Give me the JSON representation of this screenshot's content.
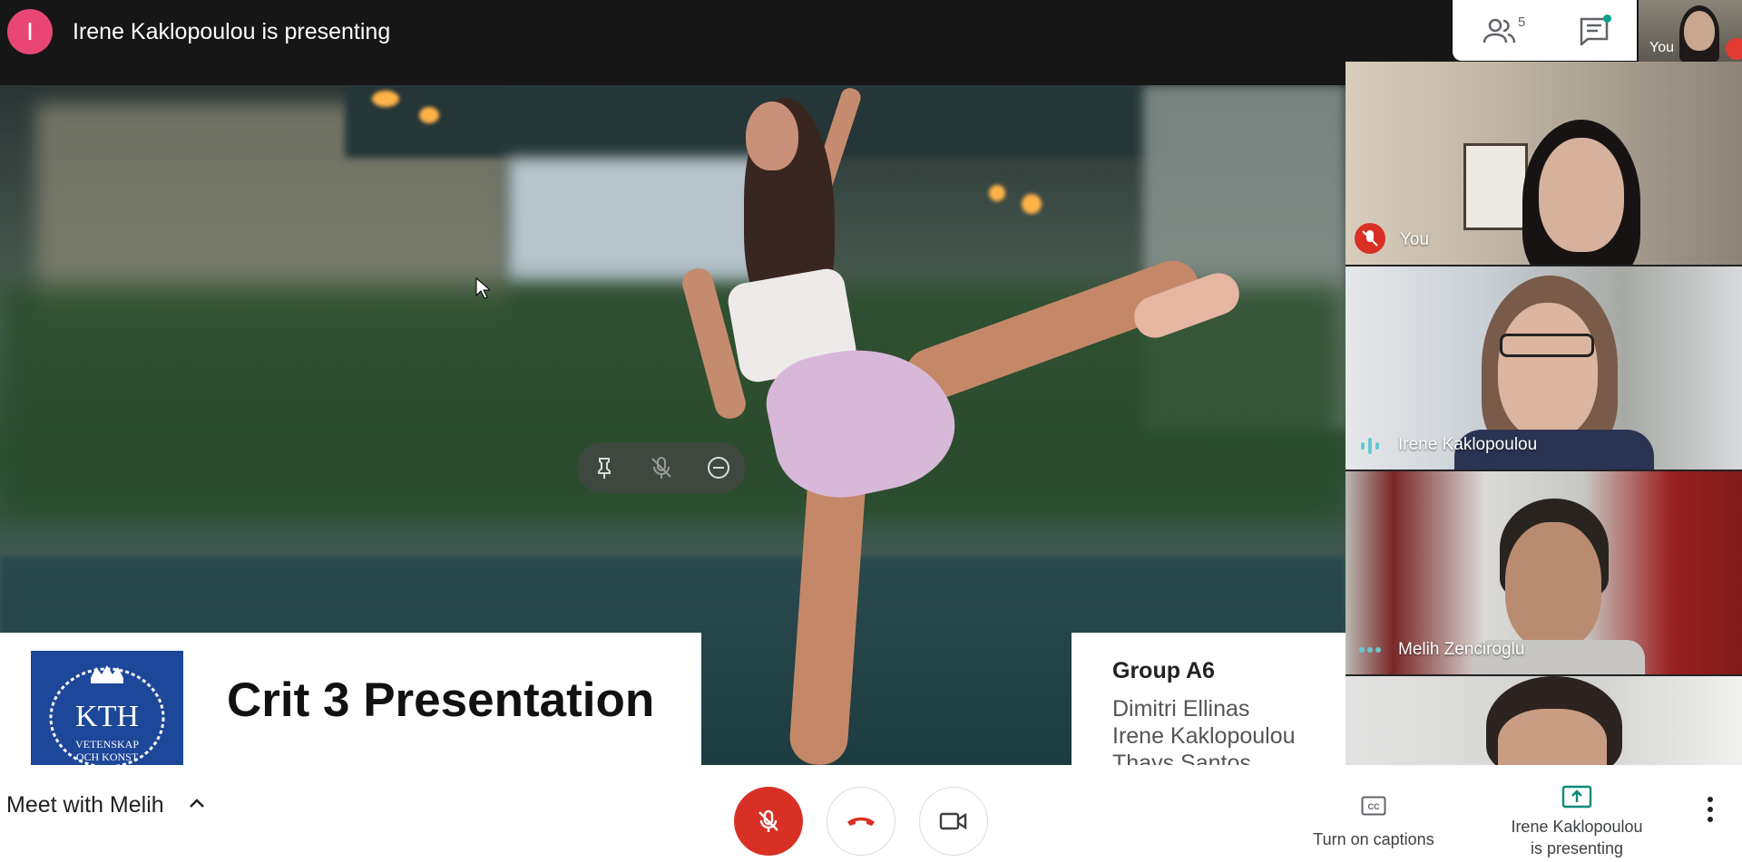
{
  "header": {
    "presenter_initial": "I",
    "presenting_text": "Irene Kaklopoulou is presenting",
    "people_count": "5",
    "self_label": "You"
  },
  "slide": {
    "logo_text_main": "KTH",
    "logo_text_sub1": "VETENSKAP",
    "logo_text_sub2": "OCH KONST",
    "title": "Crit 3 Presentation",
    "group_title": "Group A6",
    "members": [
      "Dimitri Ellinas",
      "Irene Kaklopoulou",
      "Thays Santos"
    ]
  },
  "participants": [
    {
      "name": "You",
      "status": "muted"
    },
    {
      "name": "Irene Kaklopoulou",
      "status": "speaking"
    },
    {
      "name": "Melih Zenciroglu",
      "status": "active"
    },
    {
      "name": "",
      "status": "video"
    }
  ],
  "bottom": {
    "meeting_title": "Meet with Melih",
    "captions_label": "Turn on captions",
    "presenting_line1": "Irene Kaklopoulou",
    "presenting_line2": "is presenting"
  },
  "colors": {
    "avatar": "#e94675",
    "danger": "#d93025",
    "accent": "#0aa389",
    "kth_blue": "#1d4799"
  },
  "icons": [
    "people-icon",
    "chat-icon",
    "pin-icon",
    "mic-off-icon",
    "remove-icon",
    "chevron-up-icon",
    "hang-up-icon",
    "camera-icon",
    "captions-icon",
    "present-icon",
    "more-vert-icon"
  ]
}
